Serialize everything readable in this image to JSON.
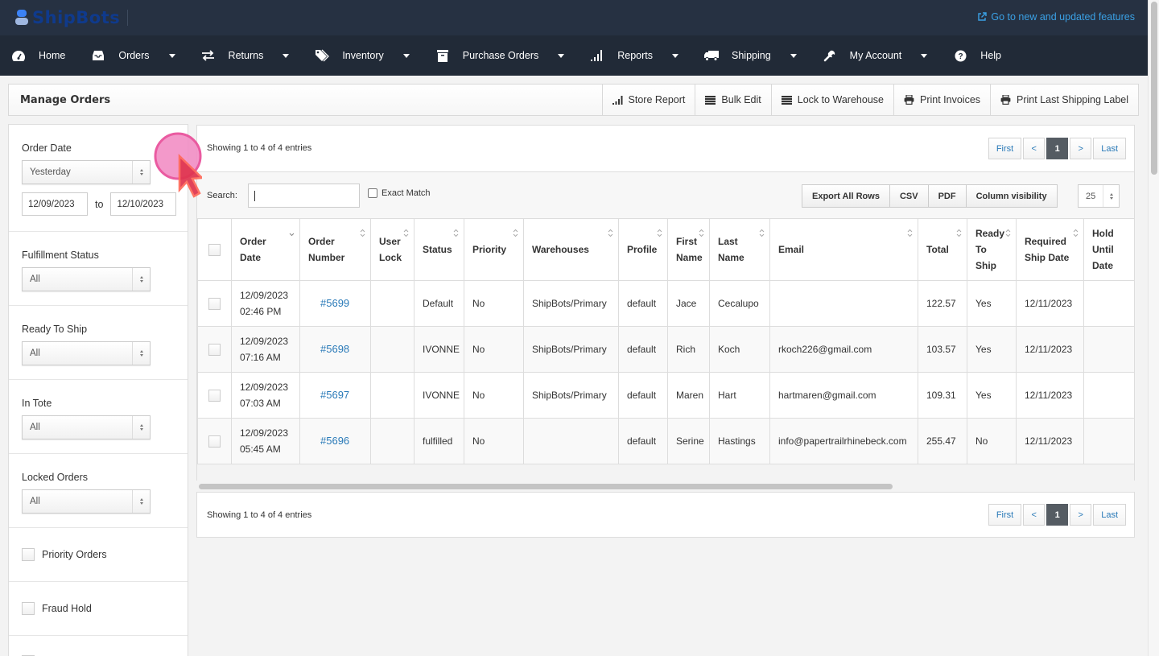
{
  "app": {
    "brand": "ShipBots",
    "new_features_link": "Go to new and updated features"
  },
  "nav": [
    {
      "label": "Home",
      "icon": "dashboard-icon",
      "dropdown": false
    },
    {
      "label": "Orders",
      "icon": "inbox-icon",
      "dropdown": true
    },
    {
      "label": "Returns",
      "icon": "exchange-icon",
      "dropdown": true
    },
    {
      "label": "Inventory",
      "icon": "tags-icon",
      "dropdown": true
    },
    {
      "label": "Purchase Orders",
      "icon": "archive-icon",
      "dropdown": true
    },
    {
      "label": "Reports",
      "icon": "signal-icon",
      "dropdown": true
    },
    {
      "label": "Shipping",
      "icon": "truck-icon",
      "dropdown": true
    },
    {
      "label": "My Account",
      "icon": "wrench-icon",
      "dropdown": true
    },
    {
      "label": "Help",
      "icon": "question-circle-icon",
      "dropdown": false
    }
  ],
  "header": {
    "title": "Manage Orders",
    "buttons": [
      {
        "label": "Store Report",
        "icon": "signal-icon"
      },
      {
        "label": "Bulk Edit",
        "icon": "list-icon"
      },
      {
        "label": "Lock to Warehouse",
        "icon": "list-icon"
      },
      {
        "label": "Print Invoices",
        "icon": "print-icon"
      },
      {
        "label": "Print Last Shipping Label",
        "icon": "print-icon"
      }
    ]
  },
  "filters": {
    "order_date": {
      "label": "Order Date",
      "selected": "Yesterday",
      "from": "12/09/2023",
      "to_label": "to",
      "to": "12/10/2023"
    },
    "fulfillment_status": {
      "label": "Fulfillment Status",
      "selected": "All"
    },
    "ready_to_ship": {
      "label": "Ready To Ship",
      "selected": "All"
    },
    "in_tote": {
      "label": "In Tote",
      "selected": "All"
    },
    "locked_orders": {
      "label": "Locked Orders",
      "selected": "All"
    },
    "priority_orders": {
      "label": "Priority Orders",
      "checked": false
    },
    "fraud_hold": {
      "label": "Fraud Hold",
      "checked": false
    }
  },
  "table_info": {
    "showing": "Showing 1 to 4 of 4 entries",
    "pagination": {
      "first": "First",
      "prev": "<",
      "current": "1",
      "next": ">",
      "last": "Last"
    },
    "search_label": "Search:",
    "search_value": "",
    "exact_match_label": "Exact Match",
    "export_buttons": [
      "Export All Rows",
      "CSV",
      "PDF",
      "Column visibility"
    ],
    "page_length": "25"
  },
  "table": {
    "columns": [
      {
        "label": "",
        "sort": "none"
      },
      {
        "label": "Order Date",
        "sort": "desc"
      },
      {
        "label": "Order Number",
        "sort": "both"
      },
      {
        "label": "User Lock",
        "sort": "both"
      },
      {
        "label": "Status",
        "sort": "both"
      },
      {
        "label": "Priority",
        "sort": "both"
      },
      {
        "label": "Warehouses",
        "sort": "both"
      },
      {
        "label": "Profile",
        "sort": "both"
      },
      {
        "label": "First Name",
        "sort": "both"
      },
      {
        "label": "Last Name",
        "sort": "both"
      },
      {
        "label": "Email",
        "sort": "both"
      },
      {
        "label": "Total",
        "sort": "both"
      },
      {
        "label": "Ready To Ship",
        "sort": "both"
      },
      {
        "label": "Required Ship Date",
        "sort": "both"
      },
      {
        "label": "Hold Until Date",
        "sort": "both"
      }
    ],
    "rows": [
      {
        "date": "12/09/2023",
        "time": "02:46 PM",
        "order": "#5699",
        "user_lock": "",
        "status": "Default",
        "priority": "No",
        "warehouse": "ShipBots/Primary",
        "profile": "default",
        "first": "Jace",
        "last": "Cecalupo",
        "email": "",
        "total": "122.57",
        "ready": "Yes",
        "required": "12/11/2023",
        "hold": ""
      },
      {
        "date": "12/09/2023",
        "time": "07:16 AM",
        "order": "#5698",
        "user_lock": "",
        "status": "IVONNE",
        "priority": "No",
        "warehouse": "ShipBots/Primary",
        "profile": "default",
        "first": "Rich",
        "last": "Koch",
        "email": "rkoch226@gmail.com",
        "total": "103.57",
        "ready": "Yes",
        "required": "12/11/2023",
        "hold": ""
      },
      {
        "date": "12/09/2023",
        "time": "07:03 AM",
        "order": "#5697",
        "user_lock": "",
        "status": "IVONNE",
        "priority": "No",
        "warehouse": "ShipBots/Primary",
        "profile": "default",
        "first": "Maren",
        "last": "Hart",
        "email": "hartmaren@gmail.com",
        "total": "109.31",
        "ready": "Yes",
        "required": "12/11/2023",
        "hold": ""
      },
      {
        "date": "12/09/2023",
        "time": "05:45 AM",
        "order": "#5696",
        "user_lock": "",
        "status": "fulfilled",
        "priority": "No",
        "warehouse": "",
        "profile": "default",
        "first": "Serine",
        "last": "Hastings",
        "email": "info@papertrailrhinebeck.com",
        "total": "255.47",
        "ready": "No",
        "required": "12/11/2023",
        "hold": ""
      }
    ]
  },
  "colors": {
    "topbar": "#263142",
    "navbar": "#212a37",
    "link": "#2a7ab8",
    "new_features": "#3aa0e4",
    "active_page": "#555c63"
  }
}
